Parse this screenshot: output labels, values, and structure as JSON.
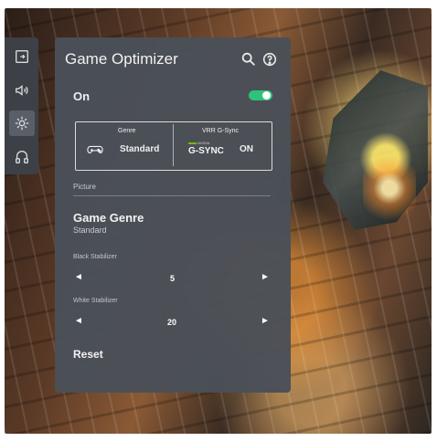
{
  "sidebar": {
    "items": [
      {
        "icon": "input-icon"
      },
      {
        "icon": "speaker-icon"
      },
      {
        "icon": "gear-icon"
      },
      {
        "icon": "headset-icon"
      }
    ]
  },
  "panel": {
    "title": "Game Optimizer",
    "search_icon": "search-icon",
    "help_icon": "help-icon",
    "power_label": "On",
    "toggle_state": "on",
    "genre_header": "Genre",
    "genre_value": "Standard",
    "vrr_header": "VRR G-Sync",
    "gsync_tiny": "NVIDIA",
    "gsync_label": "G-SYNC",
    "vrr_state": "ON",
    "section_label": "Picture",
    "game_genre_title": "Game Genre",
    "game_genre_value": "Standard",
    "black_stabilizer_label": "Black Stabilizer",
    "black_stabilizer_value": "5",
    "white_stabilizer_label": "White Stabilizer",
    "white_stabilizer_value": "20",
    "reset_label": "Reset",
    "left_arrow": "◄",
    "right_arrow": "►"
  },
  "colors": {
    "toggle_on": "#2ec27a",
    "panel": "#4a4f58",
    "gsync_green": "#77b900"
  }
}
